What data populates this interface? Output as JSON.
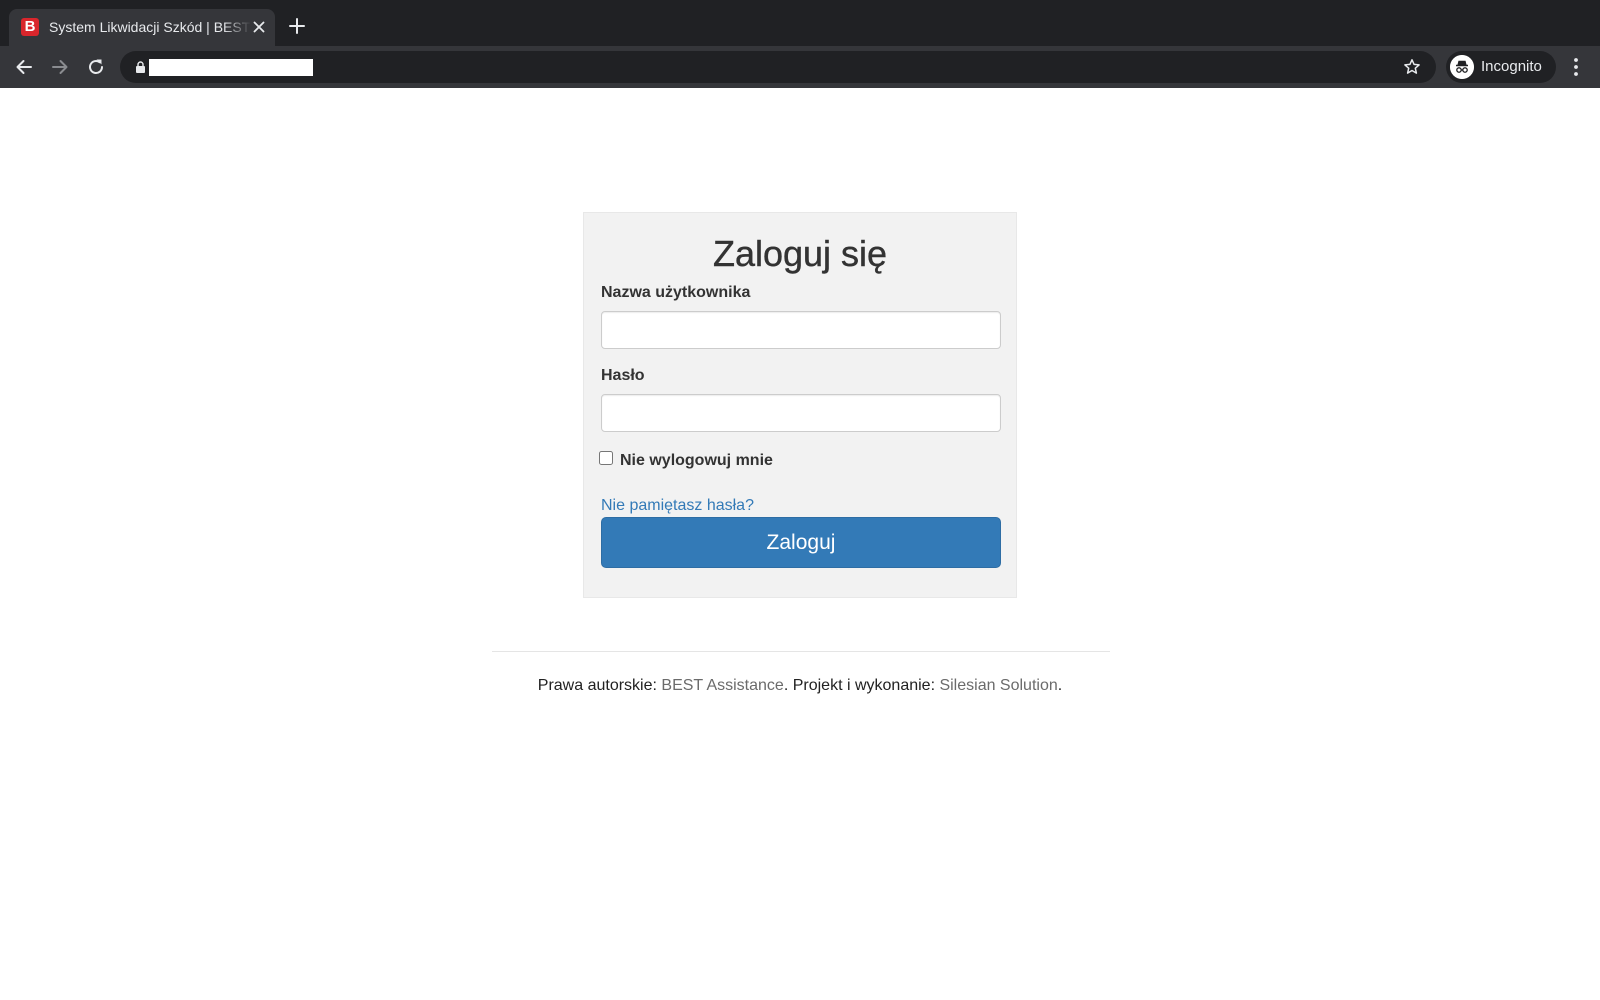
{
  "browser": {
    "tab": {
      "title": "System Likwidacji Szkód | BEST Assistance",
      "favicon_letter": "B",
      "favicon_color": "#d9262c"
    },
    "url_bar": {
      "url_redacted": true
    },
    "profile": {
      "label": "Incognito"
    },
    "icons": [
      "back-icon",
      "forward-icon",
      "reload-icon",
      "lock-icon",
      "star-icon",
      "incognito-icon",
      "menu-icon",
      "close-icon",
      "plus-icon"
    ]
  },
  "login": {
    "title": "Zaloguj się",
    "username_label": "Nazwa użytkownika",
    "username_value": "",
    "password_label": "Hasło",
    "password_value": "",
    "remember_label": "Nie wylogowuj mnie",
    "remember_checked": false,
    "forgot_link": "Nie pamiętasz hasła?",
    "submit_label": "Zaloguj"
  },
  "footer": {
    "copyright_prefix": "Prawa autorskie: ",
    "copyright_holder": "BEST Assistance",
    "project_prefix": ". Projekt i wykonanie: ",
    "project_author": "Silesian Solution",
    "suffix": "."
  },
  "colors": {
    "primary_button": "#337ab7",
    "link": "#337ab7",
    "panel_background": "#f2f2f2",
    "browser_dark": "#202124"
  }
}
